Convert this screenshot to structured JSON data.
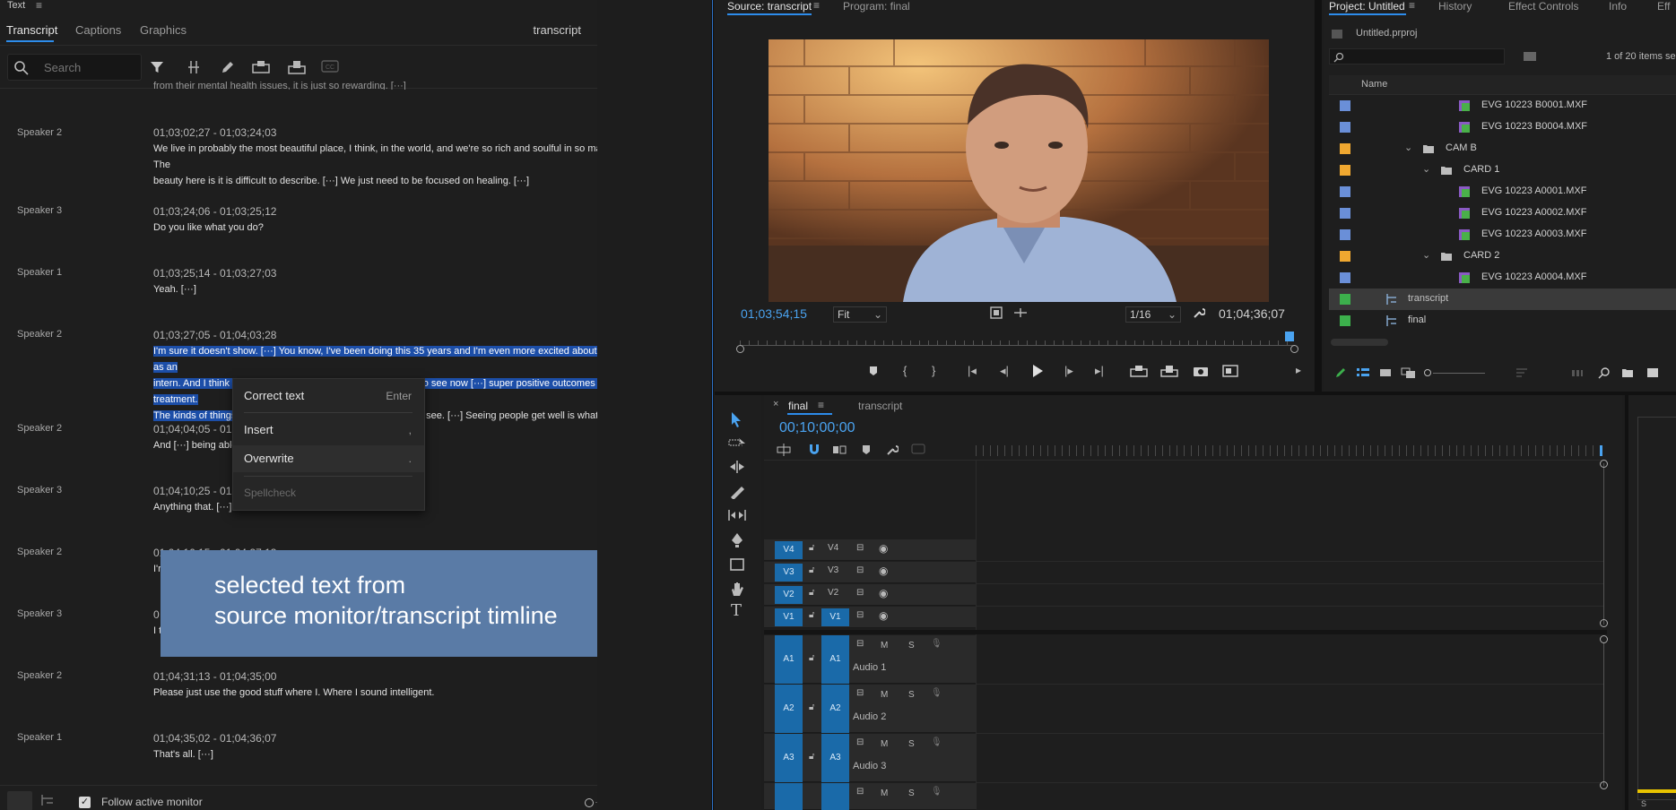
{
  "text_panel": {
    "title": "Text",
    "tabs": [
      "Transcript",
      "Captions",
      "Graphics"
    ],
    "sequence_name": "transcript",
    "search_placeholder": "Search",
    "partial_top_line": "from their mental health issues, it is just so rewarding. [···]",
    "entries": [
      {
        "speaker": "Speaker 2",
        "timecode": "01;03;02;27 - 01;03;24;03",
        "lines": [
          "We live in probably the most beautiful place, I think, in the world, and we're so rich and soulful in so many ways here. The",
          "beauty here is it is difficult to describe. [···] We just need to be focused on healing. [···]"
        ]
      },
      {
        "speaker": "Speaker 3",
        "timecode": "01;03;24;06 - 01;03;25;12",
        "lines": [
          "Do you like what you do?"
        ]
      },
      {
        "speaker": "Speaker 1",
        "timecode": "01;03;25;14 - 01;03;27;03",
        "lines": [
          "Yeah. [···]"
        ]
      },
      {
        "speaker": "Speaker 2",
        "timecode": "01;03;27;05 - 01;04;03;28",
        "lines": [
          "I'm sure it doesn't show. [···] You know, I've been doing this 35 years and I'm even more excited about it than I was as an",
          "intern. And I think it's precisely because [···] we're really able to see now [···] super positive outcomes [···] from treatment.",
          "The kinds of things",
          "o see. [···] Seeing people get well is what this is about."
        ]
      },
      {
        "speaker": "Speaker 2",
        "timecode": "01;04;04;05 - 01",
        "lines": [
          "And [···] being able"
        ]
      },
      {
        "speaker": "Speaker 3",
        "timecode": "01;04;10;25 - 01",
        "lines": [
          "Anything that. [···]"
        ]
      },
      {
        "speaker": "Speaker 2",
        "timecode": "01;04;16;15 - 01;04;27;13",
        "lines": [
          "I'r"
        ]
      },
      {
        "speaker": "Speaker 3",
        "timecode": "0",
        "lines": [
          "I t"
        ]
      },
      {
        "speaker": "Speaker 2",
        "timecode": "01;04;31;13 - 01;04;35;00",
        "lines": [
          "Please just use the good stuff where I. Where I sound intelligent."
        ]
      },
      {
        "speaker": "Speaker 1",
        "timecode": "01;04;35;02 - 01;04;36;07",
        "lines": [
          "That's all. [···]"
        ]
      }
    ],
    "context_menu": {
      "items": [
        {
          "label": "Correct text",
          "shortcut": "Enter"
        },
        {
          "label": "Insert",
          "shortcut": ","
        },
        {
          "label": "Overwrite",
          "shortcut": "."
        },
        {
          "label": "Spellcheck",
          "shortcut": ""
        }
      ]
    },
    "annotation": {
      "line1": "selected text from",
      "line2": "source monitor/transcript timline"
    },
    "footer": {
      "follow_label": "Follow active monitor",
      "follow_checked": true
    }
  },
  "source_monitor": {
    "tabs": [
      "Source: transcript",
      "Program: final"
    ],
    "timecode_in": "01;03;54;15",
    "fit": "Fit",
    "resolution": "1/16",
    "timecode_out": "01;04;36;07"
  },
  "project": {
    "tabs": [
      "Project: Untitled",
      "History",
      "Effect Controls",
      "Info",
      "Eff"
    ],
    "file": "Untitled.prproj",
    "items_count": "1 of 20 items se",
    "column_name": "Name",
    "rows": [
      {
        "name": "EVG 10223 B0001.MXF",
        "color": "#6a8fd8",
        "kind": "clip",
        "indent": 3
      },
      {
        "name": "EVG 10223 B0004.MXF",
        "color": "#6a8fd8",
        "kind": "clip",
        "indent": 3
      },
      {
        "name": "CAM B",
        "color": "#f0a830",
        "kind": "folder",
        "indent": 1
      },
      {
        "name": "CARD 1",
        "color": "#f0a830",
        "kind": "folder",
        "indent": 2
      },
      {
        "name": "EVG 10223 A0001.MXF",
        "color": "#6a8fd8",
        "kind": "clip",
        "indent": 3
      },
      {
        "name": "EVG 10223 A0002.MXF",
        "color": "#6a8fd8",
        "kind": "clip",
        "indent": 3
      },
      {
        "name": "EVG 10223 A0003.MXF",
        "color": "#6a8fd8",
        "kind": "clip",
        "indent": 3
      },
      {
        "name": "CARD 2",
        "color": "#f0a830",
        "kind": "folder",
        "indent": 2
      },
      {
        "name": "EVG 10223 A0004.MXF",
        "color": "#6a8fd8",
        "kind": "clip",
        "indent": 3
      },
      {
        "name": "transcript",
        "color": "#3cb04c",
        "kind": "sequence",
        "indent": 0
      },
      {
        "name": "final",
        "color": "#3cb04c",
        "kind": "sequence",
        "indent": 0
      }
    ]
  },
  "timeline": {
    "tabs": [
      "final",
      "transcript"
    ],
    "timecode": "00;10;00;00",
    "video_tracks": [
      "V4",
      "V3",
      "V2",
      "V1"
    ],
    "audio_tracks": [
      {
        "id": "A1",
        "name": "Audio 1"
      },
      {
        "id": "A2",
        "name": "Audio 2"
      },
      {
        "id": "A3",
        "name": "Audio 3"
      }
    ],
    "mute_label": "M",
    "solo_label": "S"
  }
}
